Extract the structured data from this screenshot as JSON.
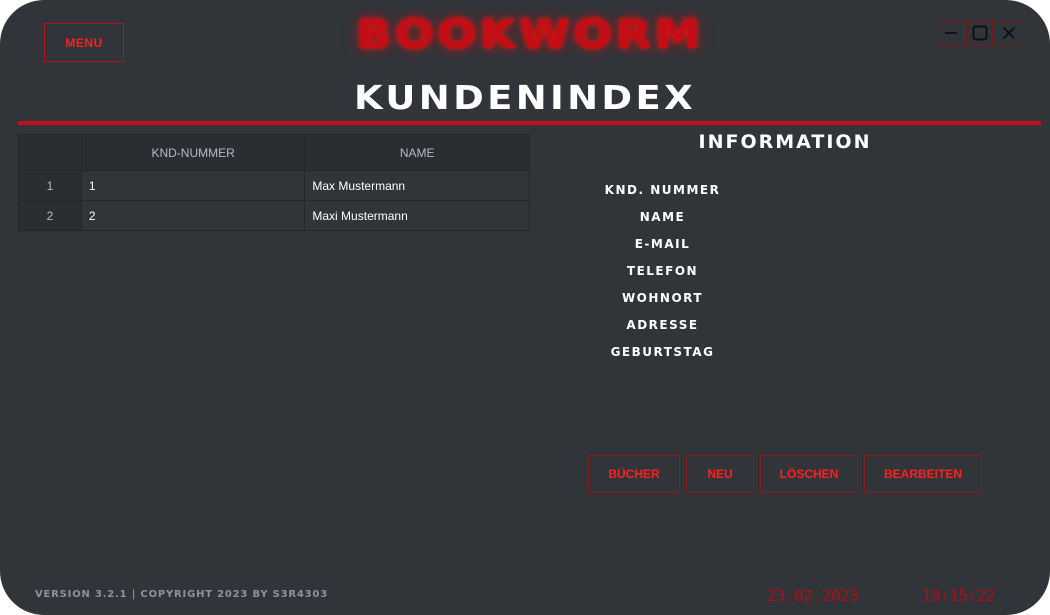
{
  "app": {
    "brand": "BOOKWORM",
    "menu_label": "MENU",
    "accent_color": "#c1121a",
    "background_color": "#31353a"
  },
  "window_controls": [
    {
      "name": "minimize",
      "icon": "minimize-icon"
    },
    {
      "name": "maximize",
      "icon": "maximize-icon"
    },
    {
      "name": "close",
      "icon": "close-icon"
    }
  ],
  "page": {
    "title": "KUNDENINDEX"
  },
  "table": {
    "columns": [
      "KND-NUMMER",
      "NAME"
    ],
    "rows": [
      {
        "index": "1",
        "knd_nummer": "1",
        "name": "Max Mustermann"
      },
      {
        "index": "2",
        "knd_nummer": "2",
        "name": "Maxi Mustermann"
      }
    ]
  },
  "info": {
    "title": "INFORMATION",
    "fields": [
      "KND. NUMMER",
      "NAME",
      "E-MAIL",
      "TELEFON",
      "WOHNORT",
      "ADRESSE",
      "GEBURTSTAG"
    ]
  },
  "actions": {
    "buecher": "BÜCHER",
    "neu": "NEU",
    "loeschen": "LÖSCHEN",
    "bearbeiten": "BEARBEITEN"
  },
  "footer": {
    "version": "VERSION 3.2.1 | COPYRIGHT 2023 BY S3R4303",
    "date": "23.02.2023",
    "time": "19:15:22"
  }
}
